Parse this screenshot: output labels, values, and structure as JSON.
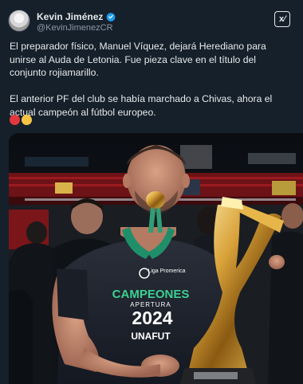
{
  "author": {
    "display_name": "Kevin Jiménez",
    "handle": "@KevinJimenezCR",
    "verified": true,
    "avatar_icon": "avatar-photo"
  },
  "actions": {
    "grok_label": "x⁄",
    "more_label": "···"
  },
  "tweet": {
    "paragraph_1": "El preparador físico, Manuel Víquez, dejará Herediano para unirse al Auda de Letonia. Fue pieza clave en el título del conjunto rojiamarillo.",
    "paragraph_2": "El anterior PF del club se había marchado a Chivas, ahora el actual campeón al fútbol europeo."
  },
  "emojis": [
    {
      "name": "red-circle-icon",
      "color": "#e0383e"
    },
    {
      "name": "yellow-circle-icon",
      "color": "#f6c445"
    }
  ],
  "photo": {
    "shirt_brand": "Liga Promerica",
    "shirt_line1": "CAMPEONES",
    "shirt_line2": "APERTURA",
    "shirt_year": "2024",
    "shirt_org": "UNAFUT"
  },
  "colors": {
    "background": "#15202b",
    "text": "#e7e9ea",
    "muted": "#8b98a5",
    "verified_blue": "#1d9bf0"
  }
}
